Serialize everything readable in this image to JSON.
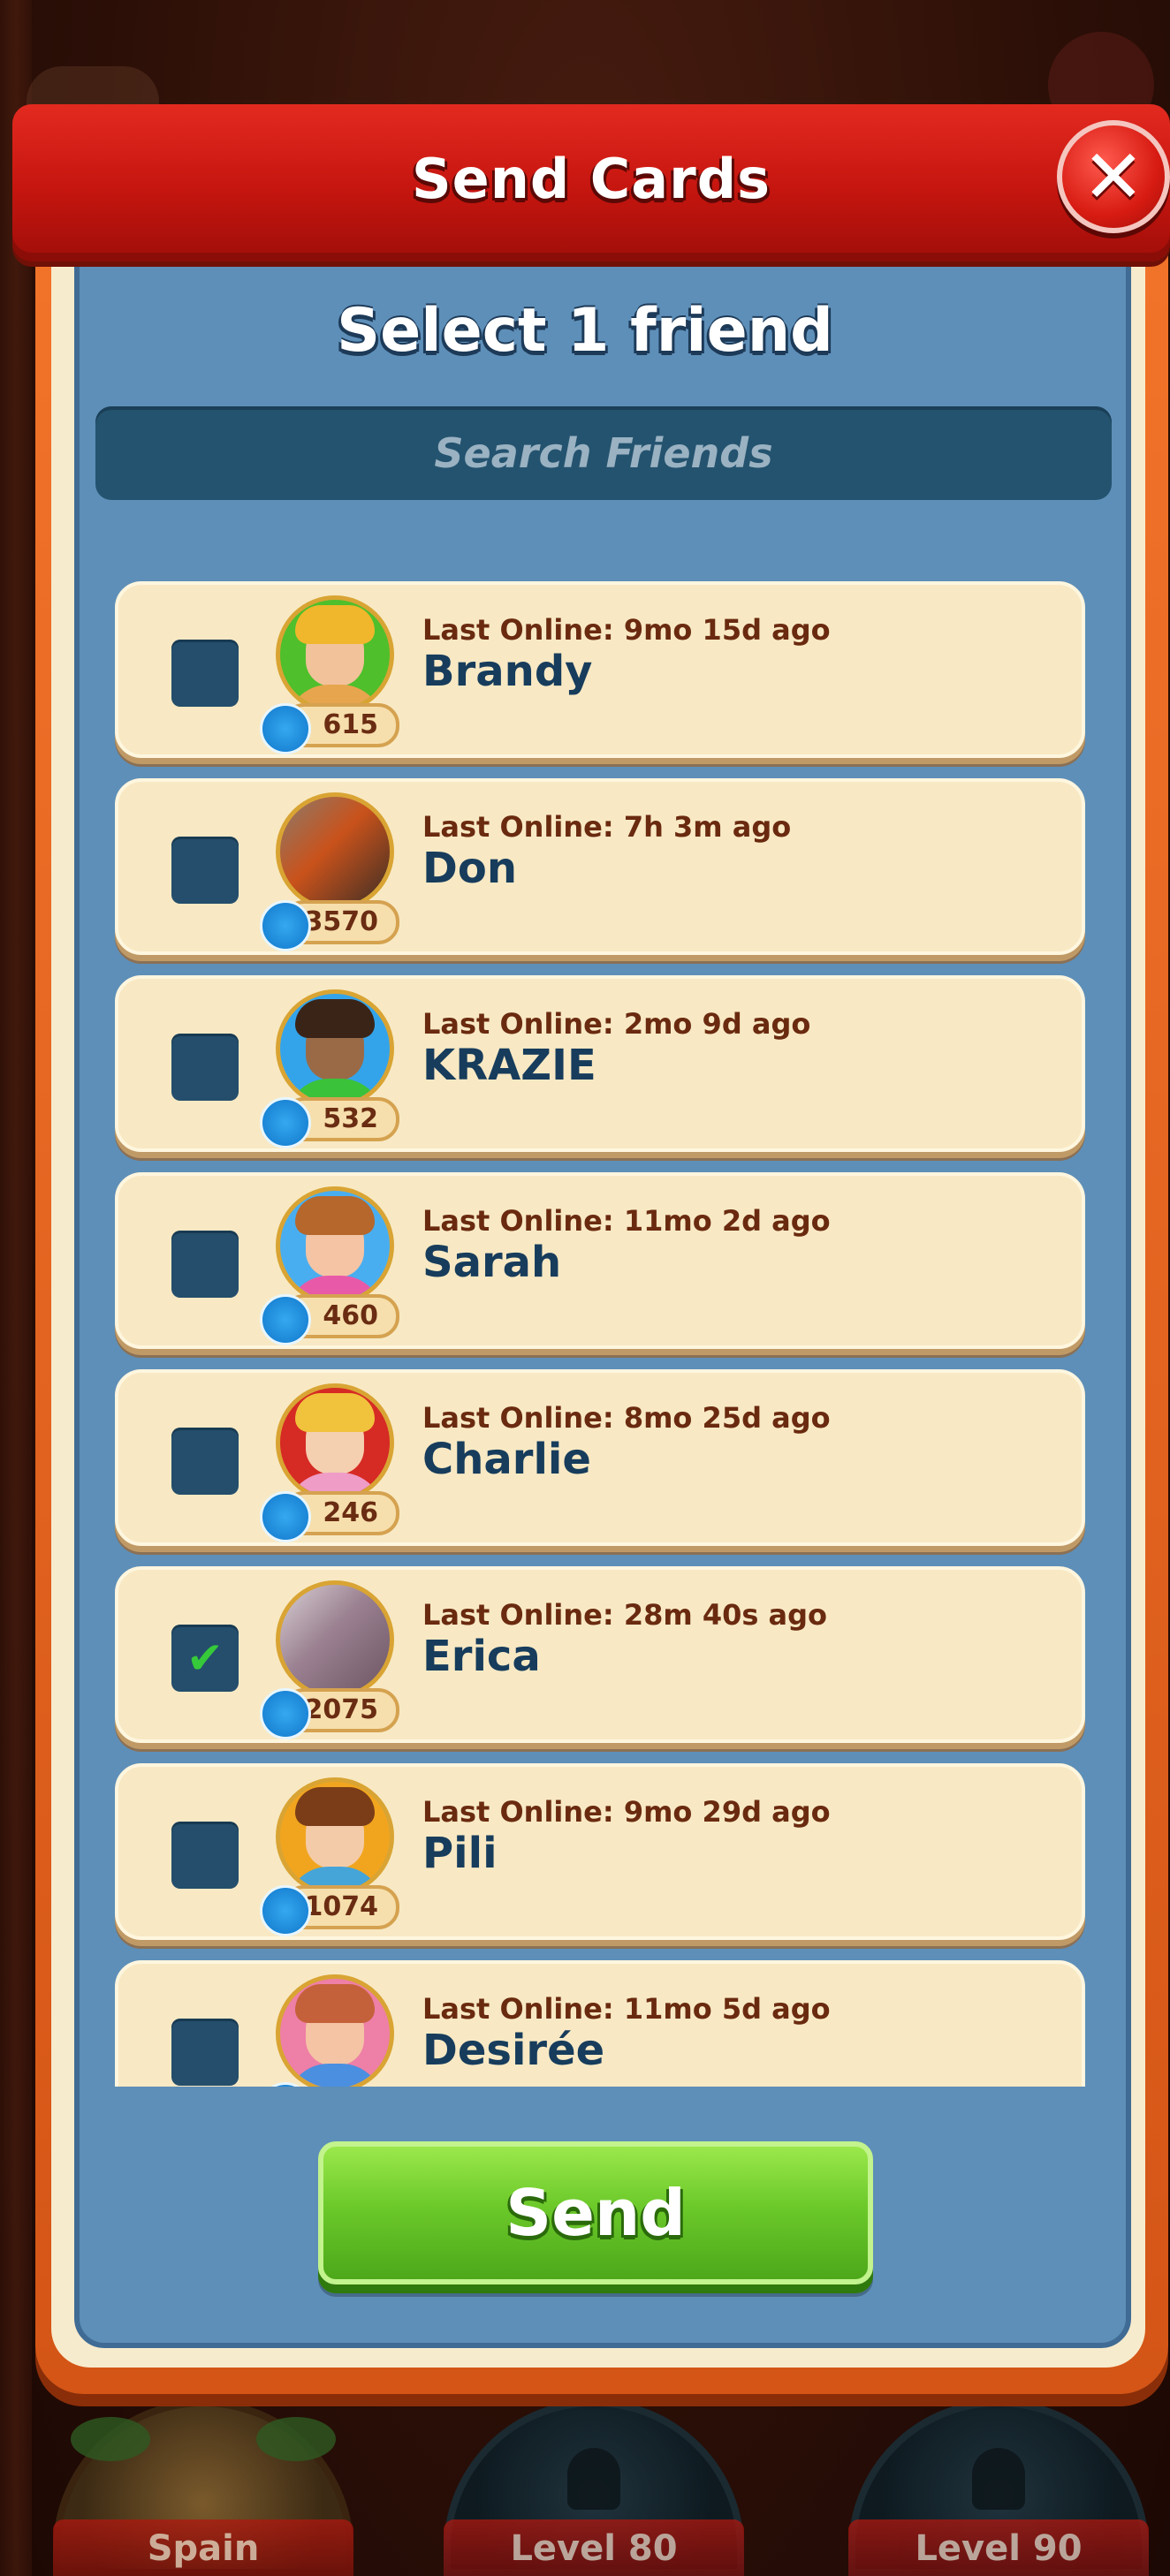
{
  "dialog": {
    "title": "Send Cards",
    "subtitle": "Select 1 friend",
    "close_label": "✕",
    "search": {
      "placeholder": "Search Friends",
      "value": ""
    },
    "send_label": "Send"
  },
  "friends": [
    {
      "last_online": "Last Online: 9mo 15d ago",
      "name": "Brandy",
      "level": "615",
      "checked": false,
      "avatar": "brandy-avatar"
    },
    {
      "last_online": "Last Online: 7h 3m ago",
      "name": "Don",
      "level": "3570",
      "checked": false,
      "avatar": "don-photo-avatar"
    },
    {
      "last_online": "Last Online: 2mo 9d ago",
      "name": "KRAZIE",
      "level": "532",
      "checked": false,
      "avatar": "krazie-avatar"
    },
    {
      "last_online": "Last Online: 11mo 2d ago",
      "name": "Sarah",
      "level": "460",
      "checked": false,
      "avatar": "sarah-avatar"
    },
    {
      "last_online": "Last Online: 8mo 25d ago",
      "name": "Charlie",
      "level": "246",
      "checked": false,
      "avatar": "charlie-avatar"
    },
    {
      "last_online": "Last Online: 28m 40s ago",
      "name": "Erica",
      "level": "2075",
      "checked": true,
      "avatar": "erica-photo-avatar"
    },
    {
      "last_online": "Last Online: 9mo 29d ago",
      "name": "Pili",
      "level": "1074",
      "checked": false,
      "avatar": "pili-avatar"
    },
    {
      "last_online": "Last Online: 11mo 5d ago",
      "name": "Desirée",
      "level": "",
      "checked": false,
      "avatar": "desiree-avatar"
    }
  ],
  "bottom_nav": {
    "spain_label": "Spain",
    "level80_label": "Level 80",
    "level90_label": "Level 90"
  },
  "colors": {
    "banner": "#c5150f",
    "panel": "#5e8fb8",
    "card": "#f8e9c4",
    "send": "#6cc92a",
    "frame": "#e3651f"
  }
}
